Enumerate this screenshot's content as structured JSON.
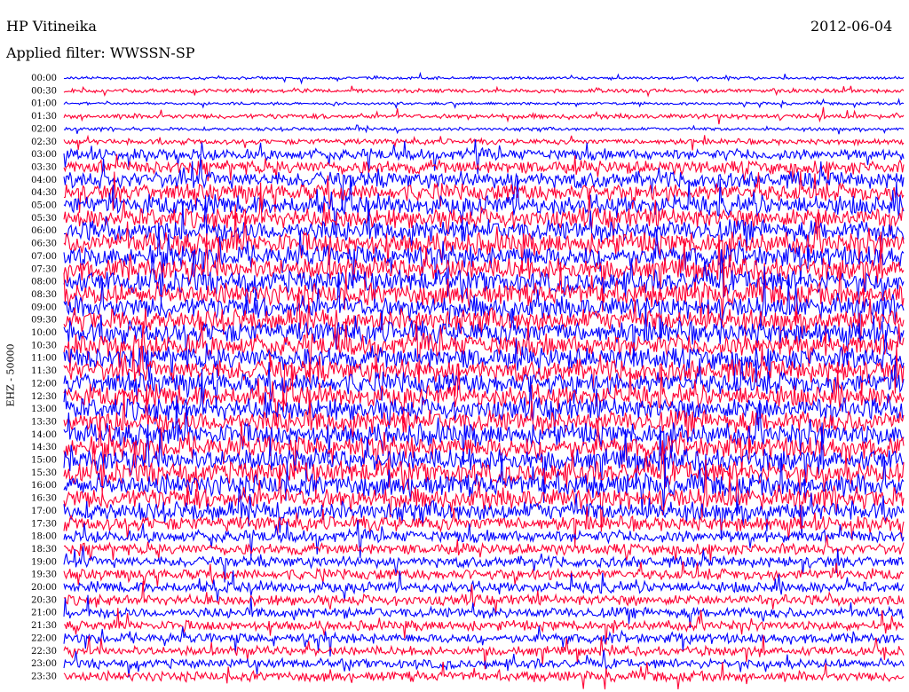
{
  "header": {
    "station": "HP Vitineika",
    "date": "2012-06-04",
    "filter": "Applied filter: WWSSN-SP"
  },
  "chart_data": {
    "type": "line",
    "title": "HP Vitineika",
    "subtitle": "Applied filter: WWSSN-SP",
    "ylabel": "EHZ - 50000",
    "xlabel": "",
    "row_labels": [
      "00:00",
      "00:30",
      "01:00",
      "01:30",
      "02:00",
      "02:30",
      "03:00",
      "03:30",
      "04:00",
      "04:30",
      "05:00",
      "05:30",
      "06:00",
      "06:30",
      "07:00",
      "07:30",
      "08:00",
      "08:30",
      "09:00",
      "09:30",
      "10:00",
      "10:30",
      "11:00",
      "11:30",
      "12:00",
      "12:30",
      "13:00",
      "13:30",
      "14:00",
      "14:30",
      "15:00",
      "15:30",
      "16:00",
      "16:30",
      "17:00",
      "17:30",
      "18:00",
      "18:30",
      "19:00",
      "19:30",
      "20:00",
      "20:30",
      "21:00",
      "21:30",
      "22:00",
      "22:30",
      "23:00",
      "23:30"
    ],
    "trace_colors": [
      "#0000ff",
      "#ff0033"
    ],
    "row_activity": [
      0.25,
      0.35,
      0.25,
      0.45,
      0.3,
      0.5,
      1.0,
      1.2,
      1.5,
      1.6,
      1.8,
      1.8,
      1.9,
      2.0,
      2.0,
      2.0,
      2.0,
      2.0,
      2.0,
      2.0,
      2.0,
      2.0,
      2.0,
      2.0,
      2.0,
      2.0,
      2.0,
      2.0,
      2.0,
      2.0,
      2.0,
      2.0,
      2.0,
      1.9,
      1.7,
      1.3,
      1.1,
      1.0,
      1.0,
      1.0,
      1.0,
      0.95,
      0.95,
      0.9,
      0.9,
      0.85,
      0.85,
      0.9
    ],
    "grid": false,
    "legend": "none"
  }
}
